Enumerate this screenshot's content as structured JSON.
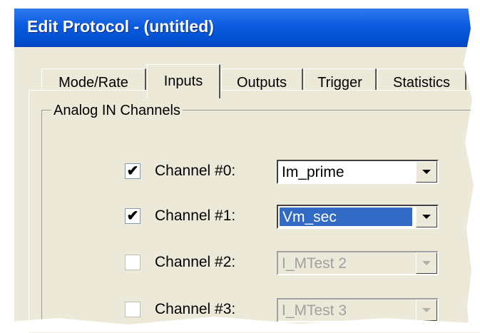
{
  "window": {
    "title": "Edit Protocol - (untitled)"
  },
  "tabs": [
    {
      "label": "Mode/Rate"
    },
    {
      "label": "Inputs"
    },
    {
      "label": "Outputs"
    },
    {
      "label": "Trigger"
    },
    {
      "label": "Statistics"
    }
  ],
  "active_tab": "Inputs",
  "group": {
    "label": "Analog IN Channels"
  },
  "channels": [
    {
      "label": "Channel #0:",
      "checked": true,
      "value": "Im_prime",
      "enabled": true,
      "selected": false
    },
    {
      "label": "Channel #1:",
      "checked": true,
      "value": "Vm_sec",
      "enabled": true,
      "selected": true
    },
    {
      "label": "Channel #2:",
      "checked": false,
      "value": "I_MTest 2",
      "enabled": false,
      "selected": false
    },
    {
      "label": "Channel #3:",
      "checked": false,
      "value": "I_MTest 3",
      "enabled": false,
      "selected": false
    }
  ],
  "colors": {
    "titlebar": "#0b5be0",
    "dialog_bg": "#ece9d8",
    "selection": "#316ac5"
  }
}
